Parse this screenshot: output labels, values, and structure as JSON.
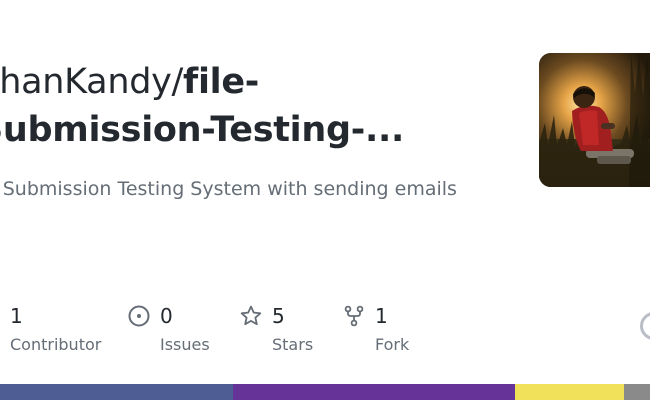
{
  "repo": {
    "owner_text": "ehanKandy/",
    "name_line1": "file-",
    "name_line2": "Submission-Testing-...",
    "description": "e Submission Testing System with sending emails"
  },
  "stats": {
    "contributors": {
      "value": "1",
      "label": "Contributor",
      "icon": "people-icon"
    },
    "issues": {
      "value": "0",
      "label": "Issues",
      "icon": "issue-opened-icon"
    },
    "stars": {
      "value": "5",
      "label": "Stars",
      "icon": "star-icon"
    },
    "forks": {
      "value": "1",
      "label": "Fork",
      "icon": "repo-forked-icon"
    }
  },
  "language_bar": {
    "colors": [
      "#4F5D95",
      "#663399",
      "#f1e05a",
      "#8a8a8a"
    ]
  }
}
